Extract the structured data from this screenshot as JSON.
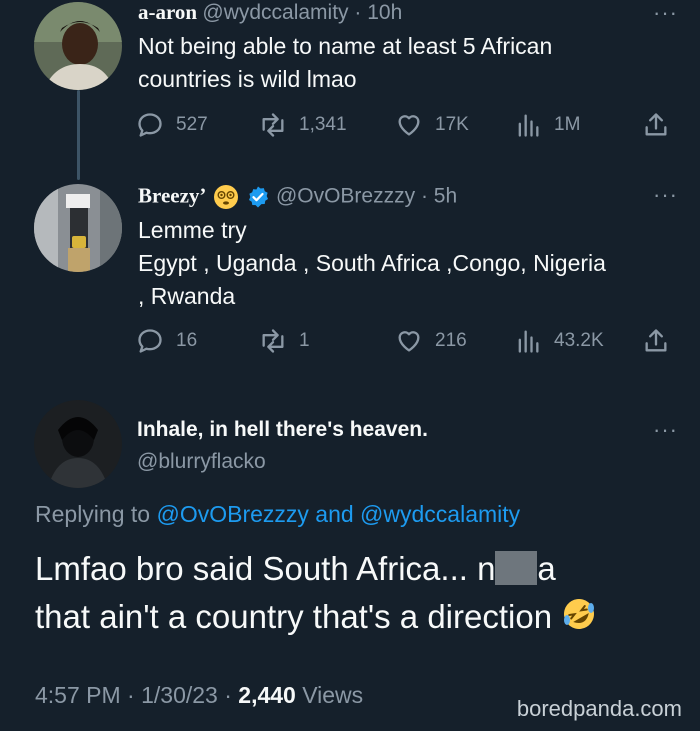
{
  "tweet1": {
    "name": "a-aron",
    "handle_time": "@wydccalamity · 10h",
    "text_line1": "Not being able to name at least 5 African",
    "text_line2": "countries is wild lmao",
    "replies": "527",
    "retweets": "1,341",
    "likes": "17K",
    "views": "1M"
  },
  "tweet2": {
    "name": "Breezy’",
    "handle_time": "@OvOBrezzzy · 5h",
    "text_line1": "Lemme try",
    "text_line2": "Egypt , Uganda , South Africa ,Congo, Nigeria",
    "text_line3": ", Rwanda",
    "replies": "16",
    "retweets": "1",
    "likes": "216",
    "views": "43.2K"
  },
  "main": {
    "name": "Inhale, in hell there's heaven.",
    "handle": "@blurryflacko",
    "replying_prefix": "Replying to ",
    "replying_users": "@OvOBrezzzy and @wydccalamity",
    "text_part1": "Lmfao bro said South Africa... n",
    "text_part2": "a",
    "text_line2": "that ain't a country that's a direction",
    "time": "4:57 PM · 1/30/23 · ",
    "views_count": "2,440",
    "views_label": " Views"
  },
  "watermark": "boredpanda.com",
  "more_label": "···",
  "colors": {
    "background": "#15202b",
    "link": "#1d9bf0",
    "muted": "#8b98a5",
    "verified": "#1d9bf0"
  }
}
